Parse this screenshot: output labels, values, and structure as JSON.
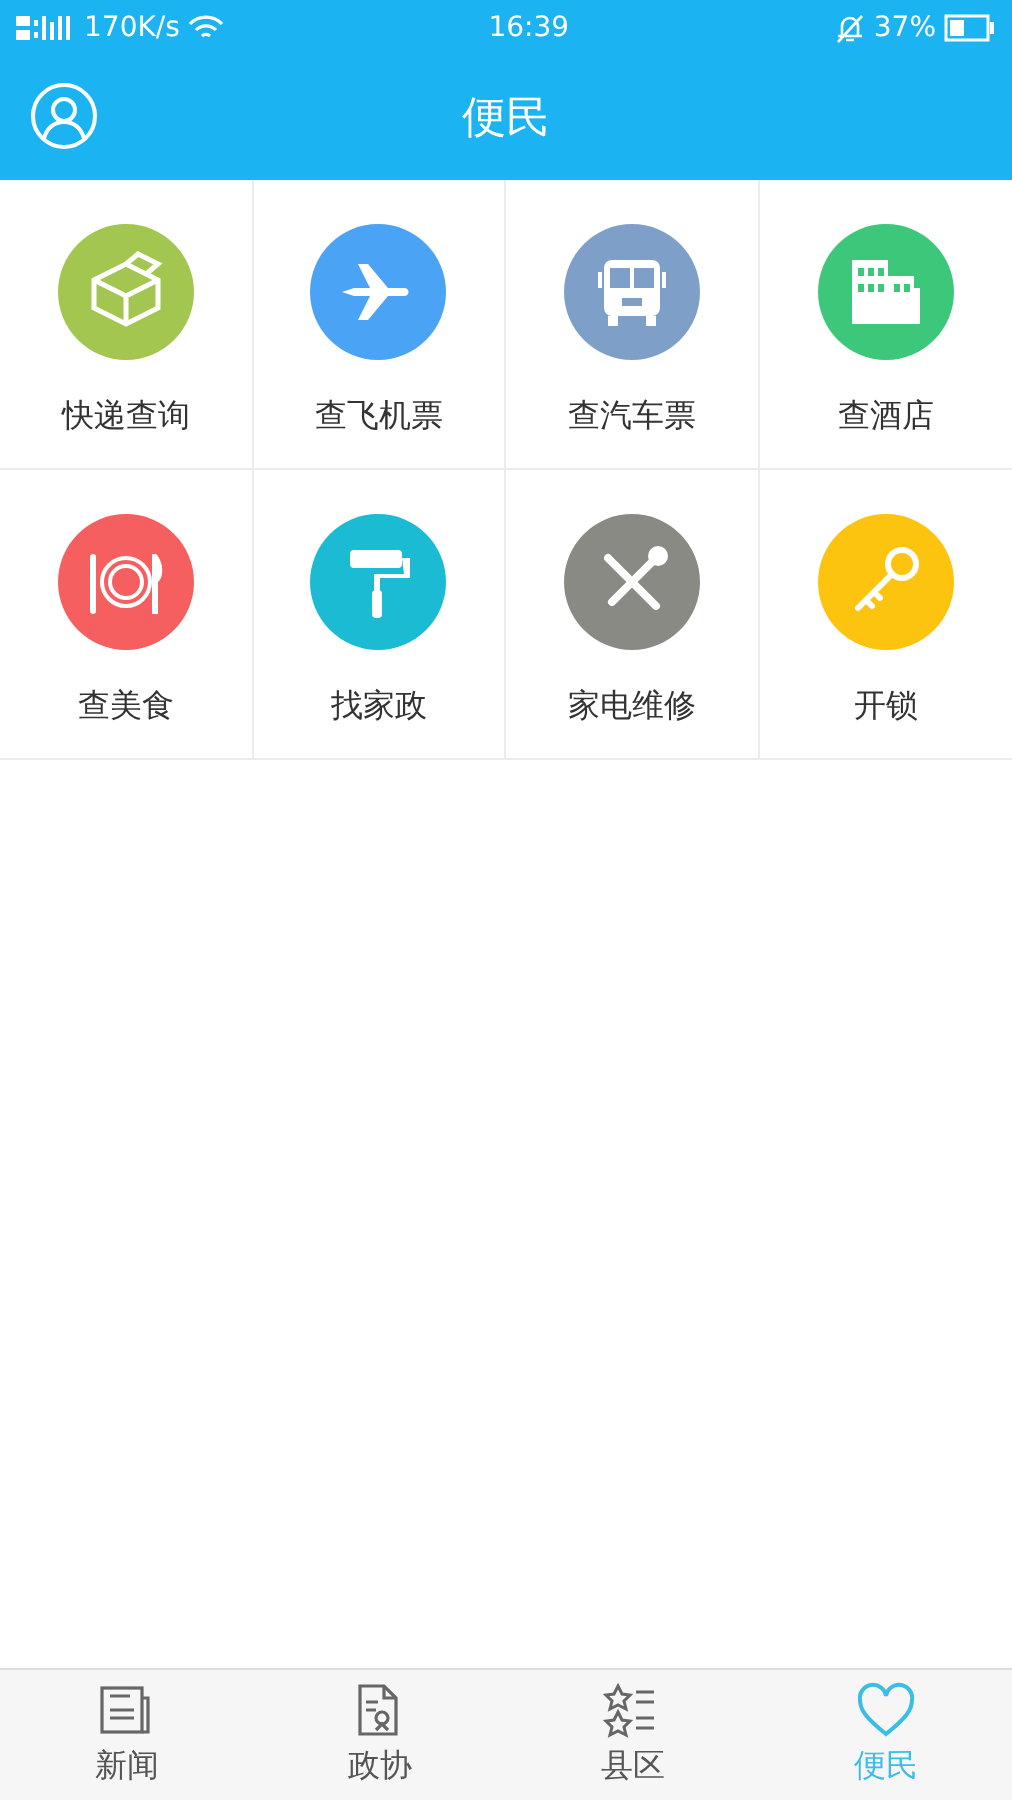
{
  "status_bar": {
    "speed": "170K/s",
    "time": "16:39",
    "battery": "37%"
  },
  "header": {
    "title": "便民"
  },
  "services": [
    {
      "label": "快递查询",
      "kind": "parcel",
      "color": "#a3c651"
    },
    {
      "label": "查飞机票",
      "kind": "plane",
      "color": "#4aa3f4"
    },
    {
      "label": "查汽车票",
      "kind": "bus",
      "color": "#7ea0c8"
    },
    {
      "label": "查酒店",
      "kind": "hotel",
      "color": "#3cc77a"
    },
    {
      "label": "查美食",
      "kind": "food",
      "color": "#f55f5f"
    },
    {
      "label": "找家政",
      "kind": "roller",
      "color": "#1bbcd3"
    },
    {
      "label": "家电维修",
      "kind": "tools",
      "color": "#8a8a84"
    },
    {
      "label": "开锁",
      "kind": "key",
      "color": "#fcc30f"
    }
  ],
  "tabs": [
    {
      "label": "新闻",
      "kind": "news",
      "selected": false
    },
    {
      "label": "政协",
      "kind": "document",
      "selected": false
    },
    {
      "label": "县区",
      "kind": "list",
      "selected": false
    },
    {
      "label": "便民",
      "kind": "heart",
      "selected": true
    }
  ]
}
